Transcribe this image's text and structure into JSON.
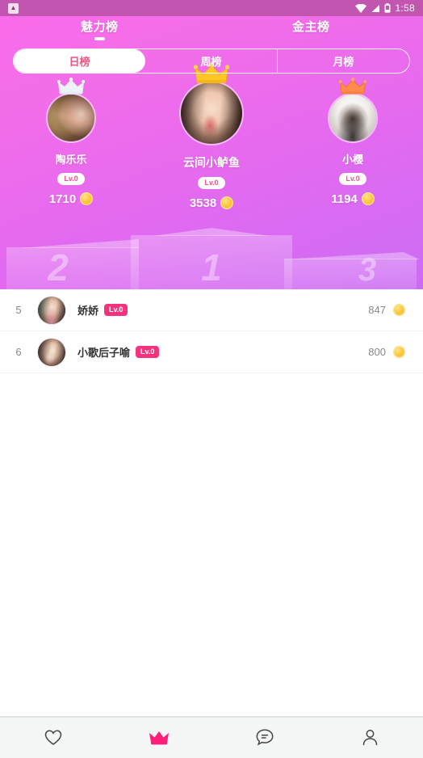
{
  "statusbar": {
    "app_icon": "app-badge-icon",
    "time": "1:58",
    "icons": [
      "wifi-icon",
      "signal-icon",
      "battery-icon"
    ]
  },
  "header": {
    "tabs": [
      {
        "label": "魅力榜",
        "active": true
      },
      {
        "label": "金主榜",
        "active": false
      }
    ],
    "segments": [
      {
        "label": "日榜",
        "active": true
      },
      {
        "label": "周榜",
        "active": false
      },
      {
        "label": "月榜",
        "active": false
      }
    ]
  },
  "podium": {
    "blocks": [
      {
        "rank": "2"
      },
      {
        "rank": "1"
      },
      {
        "rank": "3"
      }
    ],
    "winners": [
      {
        "place": 2,
        "name": "陶乐乐",
        "level": "Lv.0",
        "score": "1710",
        "crown": "silver-crown-icon",
        "crown_color": "#e8eef5"
      },
      {
        "place": 1,
        "name": "云间小鲈鱼",
        "level": "Lv.0",
        "score": "3538",
        "crown": "gold-crown-icon",
        "crown_color": "#ffc726"
      },
      {
        "place": 3,
        "name": "小樱",
        "level": "Lv.0",
        "score": "1194",
        "crown": "bronze-crown-icon",
        "crown_color": "#ff8a4c"
      }
    ]
  },
  "list": {
    "rows": [
      {
        "rank": "5",
        "name": "娇娇",
        "level": "Lv.0",
        "score": "847"
      },
      {
        "rank": "6",
        "name": "小歌后子喻",
        "level": "Lv.0",
        "score": "800"
      }
    ]
  },
  "bottomnav": {
    "items": [
      {
        "icon": "heart-icon",
        "active": false
      },
      {
        "icon": "crown-icon",
        "active": true
      },
      {
        "icon": "chat-bubble-icon",
        "active": false
      },
      {
        "icon": "person-icon",
        "active": false
      }
    ],
    "active_color": "#ff1f7a",
    "inactive_color": "#444444"
  },
  "colors": {
    "gradient_start": "#f96ceb",
    "gradient_end": "#cb6cf4",
    "accent_pink": "#f5327e",
    "statusbar": "#c255b0"
  }
}
